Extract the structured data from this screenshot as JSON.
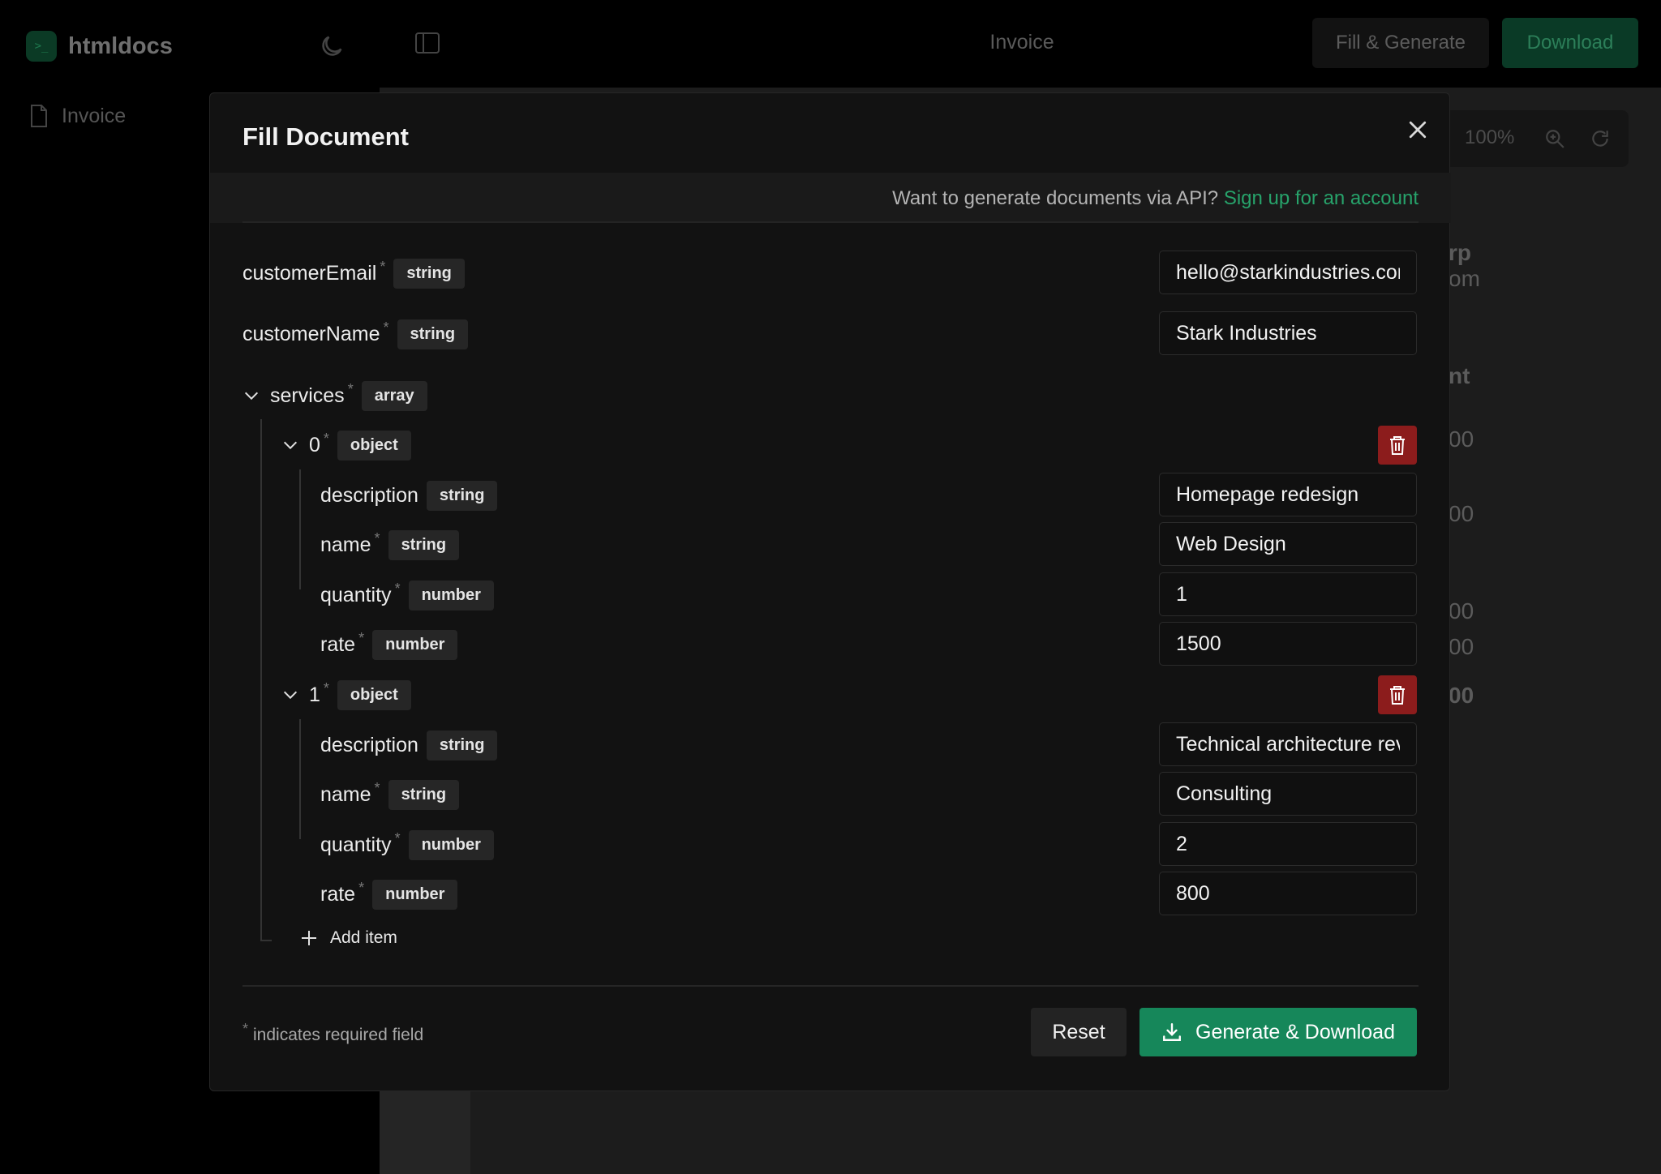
{
  "app": {
    "brand": "htmldocs",
    "logo_glyph": ">_",
    "sidebar_item": "Invoice",
    "doc_title": "Invoice",
    "fill_generate": "Fill & Generate",
    "download": "Download",
    "zoom": "100%",
    "peek": [
      "rp",
      "om",
      "nt",
      "00",
      "00",
      "00",
      "00",
      "00"
    ]
  },
  "modal": {
    "title": "Fill Document",
    "api_prompt": "Want to generate documents via API?",
    "api_link": "Sign up for an account",
    "fields": {
      "customerEmail": {
        "label": "customerEmail",
        "type": "string",
        "value": "hello@starkindustries.com"
      },
      "customerName": {
        "label": "customerName",
        "type": "string",
        "value": "Stark Industries"
      },
      "services": {
        "label": "services",
        "type": "array"
      }
    },
    "items": [
      {
        "index": "0",
        "type": "object",
        "description": {
          "label": "description",
          "type": "string",
          "value": "Homepage redesign"
        },
        "name": {
          "label": "name",
          "type": "string",
          "value": "Web Design"
        },
        "quantity": {
          "label": "quantity",
          "type": "number",
          "value": "1"
        },
        "rate": {
          "label": "rate",
          "type": "number",
          "value": "1500"
        }
      },
      {
        "index": "1",
        "type": "object",
        "description": {
          "label": "description",
          "type": "string",
          "value": "Technical architecture review"
        },
        "name": {
          "label": "name",
          "type": "string",
          "value": "Consulting"
        },
        "quantity": {
          "label": "quantity",
          "type": "number",
          "value": "2"
        },
        "rate": {
          "label": "rate",
          "type": "number",
          "value": "800"
        }
      }
    ],
    "required_mark": "*",
    "add_item": "Add item",
    "footnote": "indicates required field",
    "reset": "Reset",
    "generate": "Generate & Download"
  },
  "colors": {
    "accent": "#16875a",
    "link": "#27a36b",
    "danger": "#8c1c1c"
  }
}
